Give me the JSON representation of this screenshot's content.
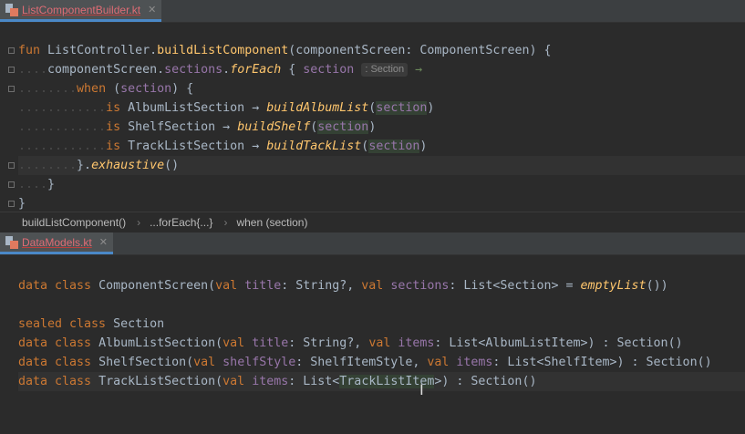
{
  "top_tab": {
    "filename": "ListComponentBuilder.kt",
    "close": "✕"
  },
  "bottom_tab": {
    "filename": "DataModels.kt",
    "close": "✕"
  },
  "breadcrumb": [
    "buildListComponent()",
    "...forEach{...}",
    "when (section)"
  ],
  "breadcrumb_sep": "›",
  "code_top": {
    "l1": {
      "kw_fun": "fun",
      "receiver": "ListController.",
      "fn": "buildListComponent",
      "p1": "(",
      "param": "componentScreen",
      "colon": ": ",
      "type": "ComponentScreen",
      "p2": ") {"
    },
    "l2": {
      "obj": "componentScreen.",
      "prop": "sections",
      "dot": ".",
      "fn": "forEach",
      "brace": " { ",
      "param": "section",
      "hint": ": Section",
      "arrow": " →"
    },
    "l3": {
      "kw": "when",
      "open": " (",
      "param": "section",
      "close": ") {"
    },
    "l4": {
      "kw": "is",
      "type": " AlbumListSection ",
      "arrow": "→ ",
      "fn": "buildAlbumList",
      "open": "(",
      "param": "section",
      "close": ")"
    },
    "l5": {
      "kw": "is",
      "type": " ShelfSection ",
      "arrow": "→ ",
      "fn": "buildShelf",
      "open": "(",
      "param": "section",
      "close": ")"
    },
    "l6": {
      "kw": "is",
      "type": " TrackListSection ",
      "arrow": "→ ",
      "fn": "buildTackList",
      "open": "(",
      "param": "section",
      "close": ")"
    },
    "l7": {
      "brace": "}.",
      "fn": "exhaustive",
      "parens": "()"
    },
    "l8": {
      "brace": "}"
    },
    "l9": {
      "brace": "}"
    }
  },
  "code_bottom": {
    "l1": {
      "kw": "data class",
      "name": " ComponentScreen(",
      "kw2": "val",
      "p1": " title",
      "t1": ": String?, ",
      "kw3": "val",
      "p2": " sections",
      "t2": ": List<Section> = ",
      "fn": "emptyList",
      "end": "())"
    },
    "l2": {
      "kw": "sealed class",
      "name": " Section"
    },
    "l3": {
      "kw": "data class",
      "name": " AlbumListSection(",
      "kw2": "val",
      "p1": " title",
      "t1": ": String?, ",
      "kw3": "val",
      "p2": " items",
      "t2": ": List<AlbumListItem>) : Section()"
    },
    "l4": {
      "kw": "data class",
      "name": " ShelfSection(",
      "kw2": "val",
      "p1": " shelfStyle",
      "t1": ": ShelfItemStyle, ",
      "kw3": "val",
      "p2": " items",
      "t2": ": List<ShelfItem>) : Section()"
    },
    "l5": {
      "kw": "data class",
      "name": " TrackListSection(",
      "kw2": "val",
      "p1": " items",
      "t1": ": List<",
      "hl": "TrackListItem",
      "t2": ">) : Section()"
    }
  }
}
